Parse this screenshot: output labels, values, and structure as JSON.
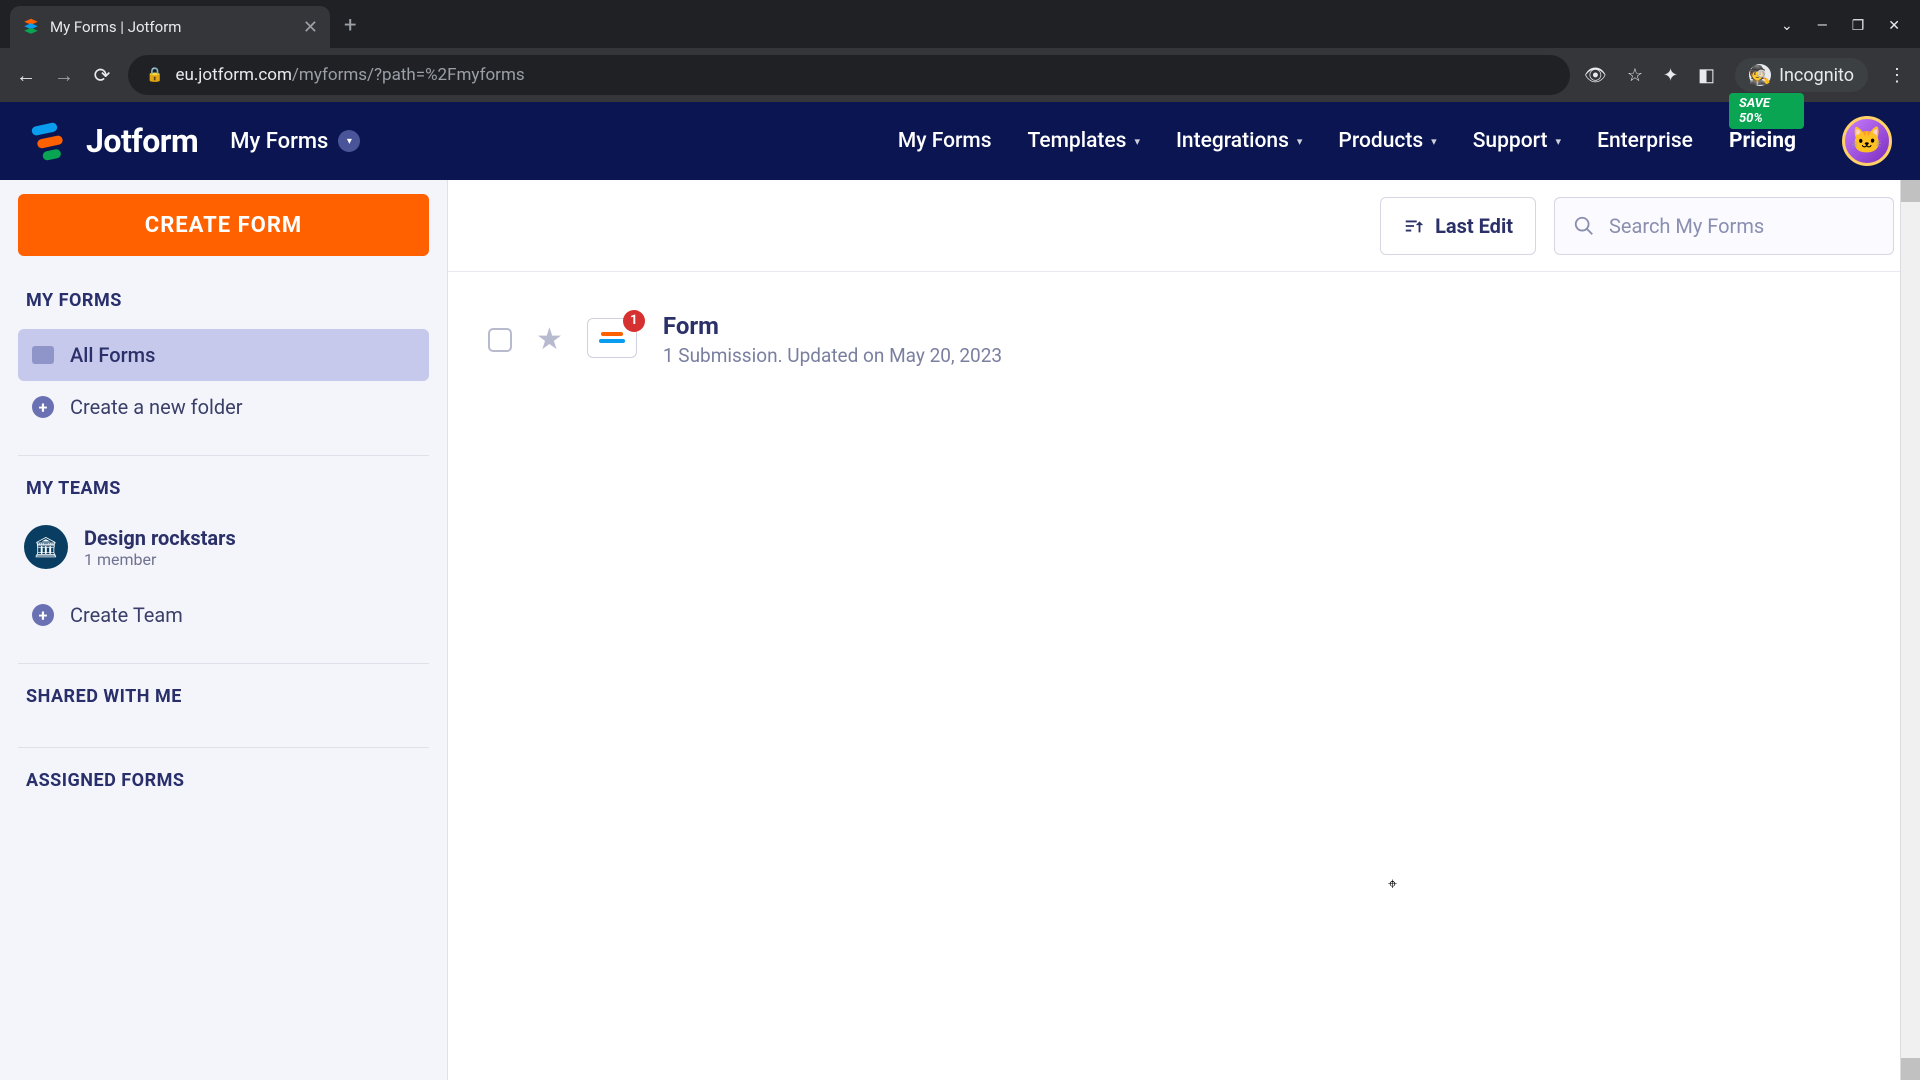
{
  "browser": {
    "tab_title": "My Forms | Jotform",
    "url_host": "eu.jotform.com",
    "url_path": "/myforms/?path=%2Fmyforms",
    "incognito_label": "Incognito"
  },
  "header": {
    "brand": "Jotform",
    "dropdown_label": "My Forms",
    "nav": {
      "my_forms": "My Forms",
      "templates": "Templates",
      "integrations": "Integrations",
      "products": "Products",
      "support": "Support",
      "enterprise": "Enterprise",
      "pricing": "Pricing"
    },
    "save_badge": "SAVE 50%"
  },
  "sidebar": {
    "create_button": "CREATE FORM",
    "sections": {
      "my_forms_label": "MY FORMS",
      "all_forms": "All Forms",
      "create_folder": "Create a new folder",
      "my_teams_label": "MY TEAMS",
      "create_team": "Create Team",
      "shared_label": "SHARED WITH ME",
      "assigned_label": "ASSIGNED FORMS"
    },
    "teams": [
      {
        "name": "Design rockstars",
        "members": "1 member"
      }
    ]
  },
  "toolbar": {
    "sort_label": "Last Edit",
    "search_placeholder": "Search My Forms"
  },
  "forms": [
    {
      "title": "Form",
      "meta": "1 Submission. Updated on May 20, 2023",
      "badge": "1"
    }
  ]
}
